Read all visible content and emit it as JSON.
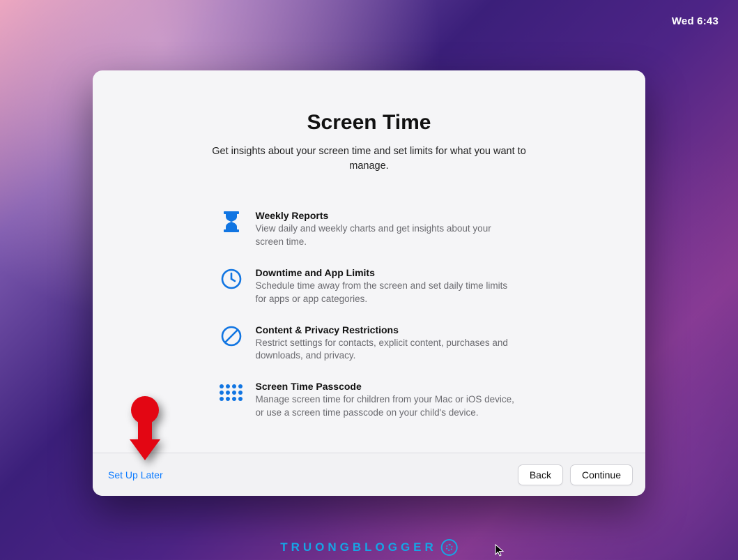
{
  "menubar": {
    "time": "Wed 6:43"
  },
  "window": {
    "title": "Screen Time",
    "subtitle": "Get insights about your screen time and set limits for what you want to manage.",
    "features": [
      {
        "icon": "hourglass-icon",
        "title": "Weekly Reports",
        "desc": "View daily and weekly charts and get insights about your screen time."
      },
      {
        "icon": "clock-icon",
        "title": "Downtime and App Limits",
        "desc": "Schedule time away from the screen and set daily time limits for apps or app categories."
      },
      {
        "icon": "nosign-icon",
        "title": "Content & Privacy Restrictions",
        "desc": "Restrict settings for contacts, explicit content, purchases and downloads, and privacy."
      },
      {
        "icon": "keypad-icon",
        "title": "Screen Time Passcode",
        "desc": "Manage screen time for children from your Mac or iOS device, or use a screen time passcode on your child's device."
      }
    ],
    "footer": {
      "setup_later": "Set Up Later",
      "back": "Back",
      "continue": "Continue"
    }
  },
  "watermark": {
    "text": "TRUONGBLOGGER"
  },
  "annotation": {
    "arrow_color": "#e30613"
  }
}
